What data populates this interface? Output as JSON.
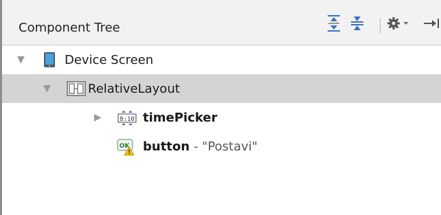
{
  "panel": {
    "title": "Component Tree",
    "toolbar": [
      {
        "icon": "expand-all-icon"
      },
      {
        "icon": "collapse-all-icon"
      },
      {
        "icon": "gear-icon"
      },
      {
        "icon": "hide-panel-icon"
      }
    ]
  },
  "tree": [
    {
      "label": "Device Screen",
      "icon": "device-screen-icon",
      "expanded": true
    },
    {
      "label": "RelativeLayout",
      "icon": "relative-layout-icon",
      "expanded": true,
      "selected": true
    },
    {
      "label": "timePicker",
      "icon": "time-picker-icon",
      "expanded": false
    },
    {
      "label": "button",
      "separator": " - ",
      "text": "\"Postavi\"",
      "icon": "button-warning-icon"
    }
  ],
  "colors": {
    "header_bg": "#f2f2f2",
    "selection_bg": "#d4d4d4",
    "icon_blue": "#3b73b9",
    "warning_yellow": "#f2c200"
  }
}
